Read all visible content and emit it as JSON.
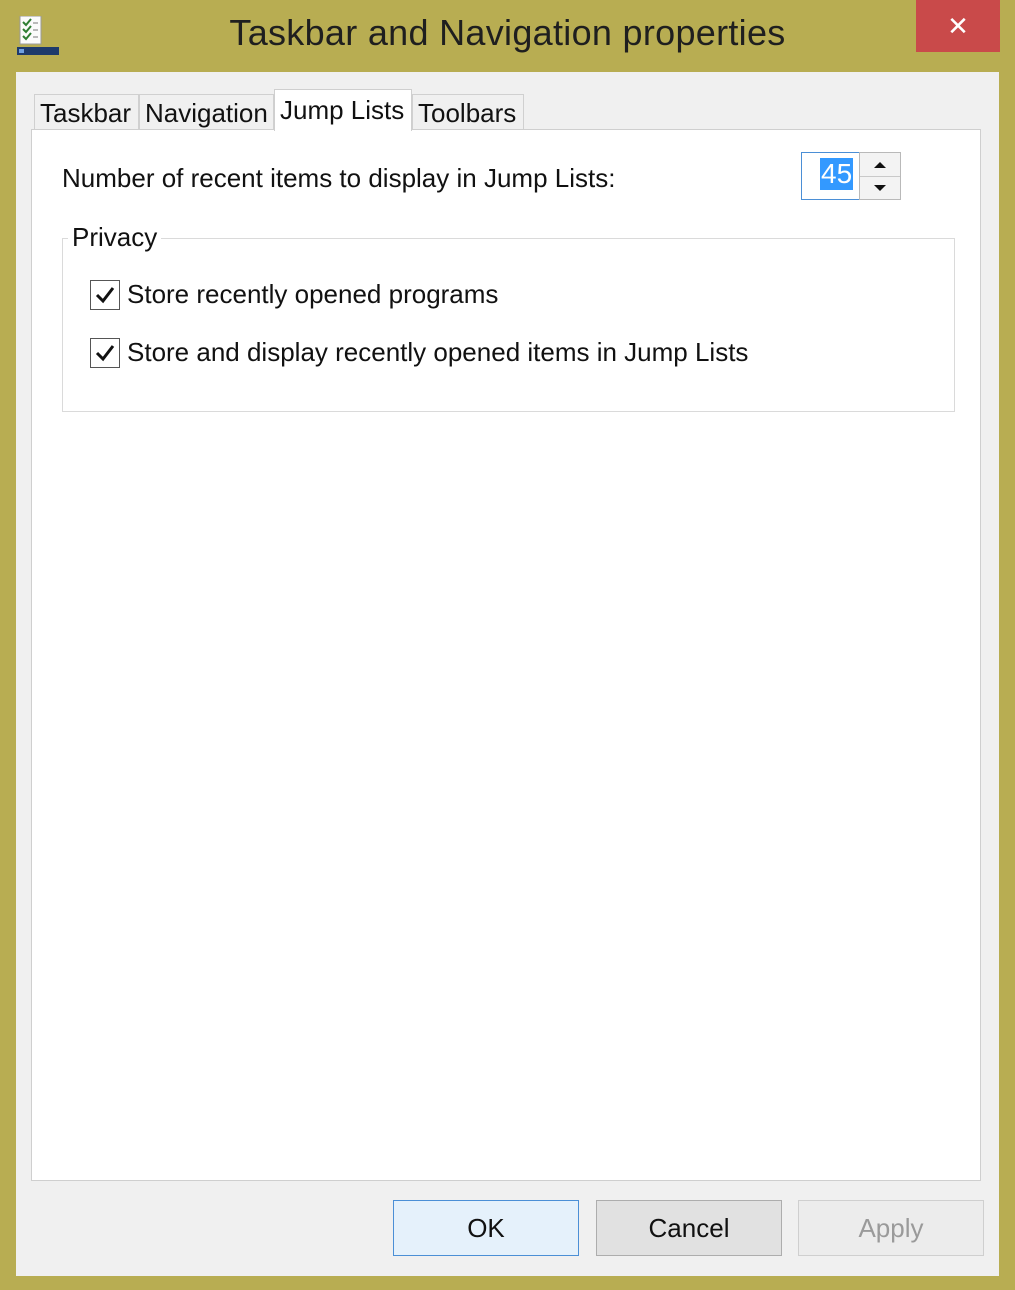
{
  "window": {
    "title": "Taskbar and Navigation properties",
    "close_glyph": "✕",
    "icon": "taskbar-properties-icon"
  },
  "tabs": [
    {
      "label": "Taskbar",
      "active": false
    },
    {
      "label": "Navigation",
      "active": false
    },
    {
      "label": "Jump Lists",
      "active": true
    },
    {
      "label": "Toolbars",
      "active": false
    }
  ],
  "jump_lists": {
    "recent_items_label": "Number of recent items to display in Jump Lists:",
    "recent_items_value": "45",
    "privacy": {
      "title": "Privacy",
      "options": [
        {
          "label": "Store recently opened programs",
          "checked": true
        },
        {
          "label": "Store and display recently opened items in Jump Lists",
          "checked": true
        }
      ]
    }
  },
  "buttons": {
    "ok": "OK",
    "cancel": "Cancel",
    "apply": "Apply"
  },
  "colors": {
    "frame": "#b8ad52",
    "close": "#c94a4a",
    "selection": "#3399ff",
    "focus": "#4b8fd6"
  }
}
